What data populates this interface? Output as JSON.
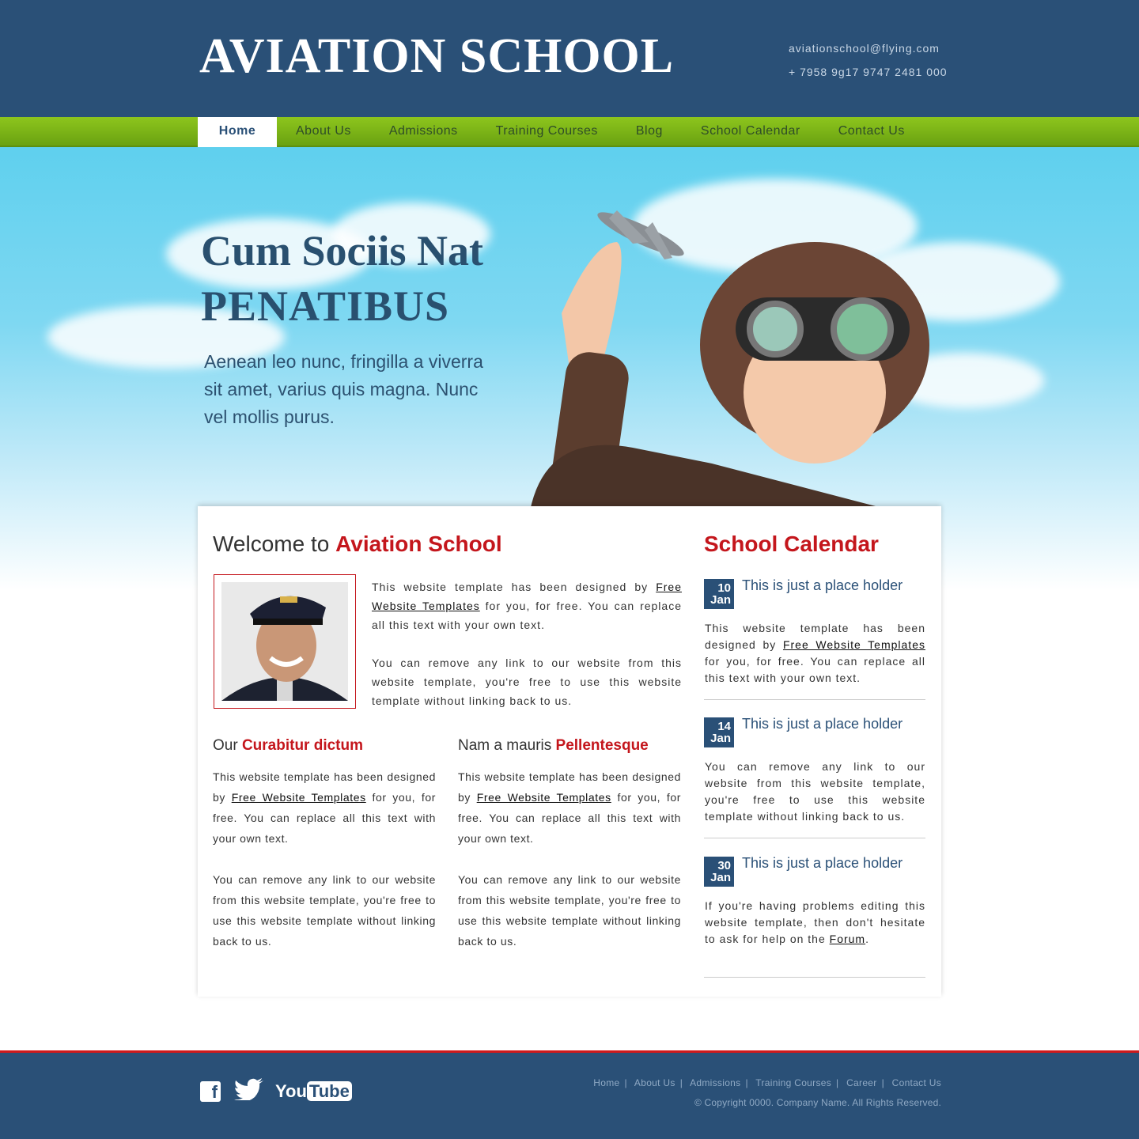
{
  "header": {
    "logo": "AVIATION SCHOOL",
    "email": "aviationschool@flying.com",
    "phone": "+ 7958 9g17 9747 2481 000"
  },
  "nav": {
    "items": [
      "Home",
      "About Us",
      "Admissions",
      "Training Courses",
      "Blog",
      "School Calendar",
      "Contact Us"
    ],
    "active": "Home"
  },
  "hero": {
    "title_line1": "Cum Sociis Nat",
    "title_line2": "PENATIBUS",
    "text": "Aenean leo nunc, fringilla a viverra sit amet, varius quis magna. Nunc vel mollis purus."
  },
  "welcome": {
    "prefix": "Welcome to ",
    "highlight": "Aviation School",
    "p1_before": "This website template has been designed by ",
    "p1_link": "Free Website Templates",
    "p1_after": " for you, for free. You can replace all this text with your own text.",
    "p2": "You can remove any link to our website from this website template, you're free to use this website template without linking back to us."
  },
  "columns": [
    {
      "prefix": "Our ",
      "highlight": "Curabitur dictum",
      "p1_before": "This website template has been designed by ",
      "p1_link": "Free Website Templates",
      "p1_after": " for you, for free. You can replace all this text with your own text.",
      "p2": "You can remove any link to our website from this website template, you're free to use this website template without linking back to us."
    },
    {
      "prefix": "Nam a mauris ",
      "highlight": "Pellentesque",
      "p1_before": "This website template has been designed by ",
      "p1_link": "Free Website Templates",
      "p1_after": " for you, for free. You can replace all this text with your own text.",
      "p2": "You can remove any link to our website from this website template, you're free to use this website template without linking back to us."
    }
  ],
  "calendar": {
    "title": "School Calendar",
    "entries": [
      {
        "day": "10",
        "month": "Jan",
        "heading": "This is just a place holder",
        "text_before": "This website template has been designed by ",
        "link": "Free Website Templates",
        "text_after": " for you, for free. You can replace all this text with your own text."
      },
      {
        "day": "14",
        "month": "Jan",
        "heading": "This is just a place holder",
        "text_before": "You can remove any link to our website from this website template, you're free to use this website template without linking back to us.",
        "link": "",
        "text_after": ""
      },
      {
        "day": "30",
        "month": "Jan",
        "heading": "This is just a place holder",
        "text_before": "If you're having problems editing this website template, then don't hesitate to ask for help on the ",
        "link": "Forum",
        "text_after": "."
      }
    ]
  },
  "footer": {
    "social": [
      "facebook-icon",
      "twitter-icon",
      "youtube-icon"
    ],
    "youtube_you": "You",
    "youtube_tube": "Tube",
    "facebook_glyph": "f",
    "twitter_glyph": "🐦",
    "links": [
      "Home",
      "About Us",
      "Admissions",
      "Training Courses",
      "Career",
      "Contact Us"
    ],
    "copyright": "© Copyright 0000. Company Name. All Rights Reserved."
  }
}
